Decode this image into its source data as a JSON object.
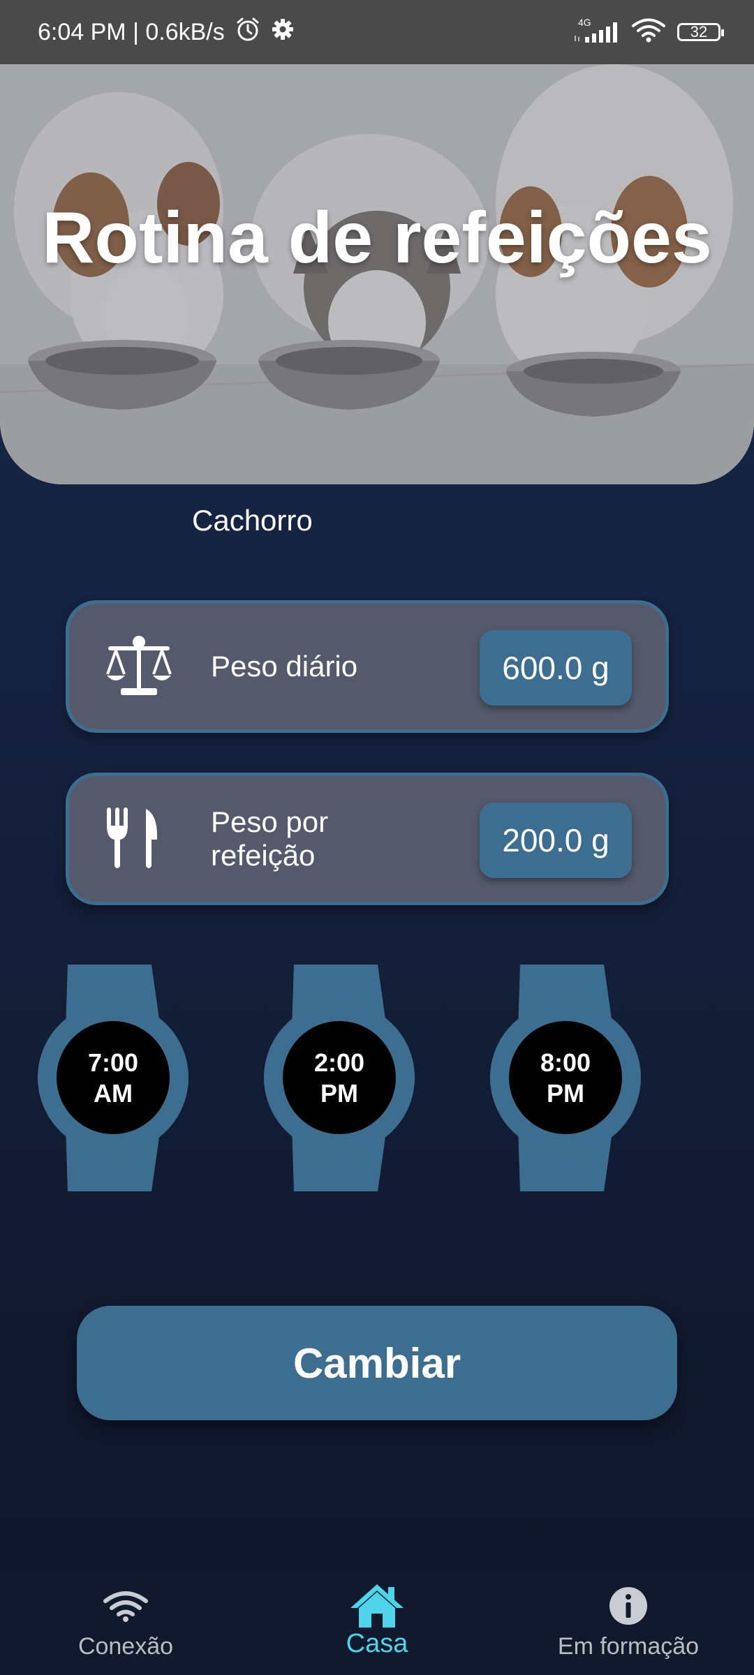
{
  "status_bar": {
    "time_speed": "6:04 PM | 0.6kB/s",
    "network_type": "4G",
    "battery": "32"
  },
  "hero": {
    "title": "Rotina de refeições"
  },
  "pet_type": "Cachorro",
  "cards": [
    {
      "label": "Peso diário",
      "value": "600.0 g",
      "icon": "scale-icon"
    },
    {
      "label": "Peso por refeição",
      "value": "200.0 g",
      "icon": "utensils-icon"
    }
  ],
  "meal_times": [
    {
      "time": "7:00",
      "period": "AM"
    },
    {
      "time": "2:00",
      "period": "PM"
    },
    {
      "time": "8:00",
      "period": "PM"
    }
  ],
  "change_button": "Cambiar",
  "bottom_nav": [
    {
      "label": "Conexão",
      "icon": "wifi-icon",
      "active": false
    },
    {
      "label": "Casa",
      "icon": "home-icon",
      "active": true
    },
    {
      "label": "Em formação",
      "icon": "info-icon",
      "active": false
    }
  ],
  "colors": {
    "accent": "#3e6e8f",
    "card_bg": "#545a6b",
    "nav_active": "#4fd3e8",
    "background": "#152240"
  }
}
